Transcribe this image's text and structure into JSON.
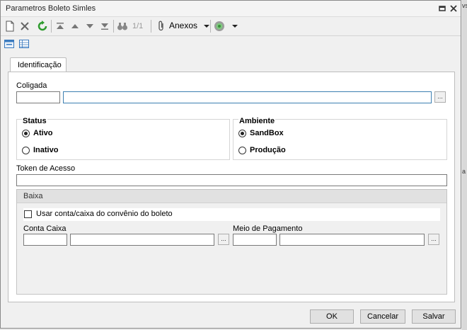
{
  "window": {
    "title": "Parametros Boleto Simles"
  },
  "toolbar": {
    "record_counter": "1/1",
    "anexos_label": "Anexos"
  },
  "tabs": [
    {
      "label": "Identificação"
    }
  ],
  "form": {
    "coligada_label": "Coligada",
    "coligada_code": "",
    "coligada_name": "",
    "lookup_label": "...",
    "status": {
      "title": "Status",
      "options": [
        "Ativo",
        "Inativo"
      ],
      "selected": "Ativo"
    },
    "ambiente": {
      "title": "Ambiente",
      "options": [
        "SandBox",
        "Produção"
      ],
      "selected": "SandBox"
    },
    "token_label": "Token de Acesso",
    "token_value": "",
    "baixa": {
      "title": "Baixa",
      "checkbox_label": "Usar conta/caixa do convênio do boleto",
      "checkbox_checked": false,
      "conta_caixa_label": "Conta Caixa",
      "meio_pagamento_label": "Meio de Pagamento"
    }
  },
  "buttons": {
    "ok": "OK",
    "cancel": "Cancelar",
    "save": "Salvar"
  },
  "background": {
    "fragments": [
      "vs",
      "a"
    ]
  }
}
